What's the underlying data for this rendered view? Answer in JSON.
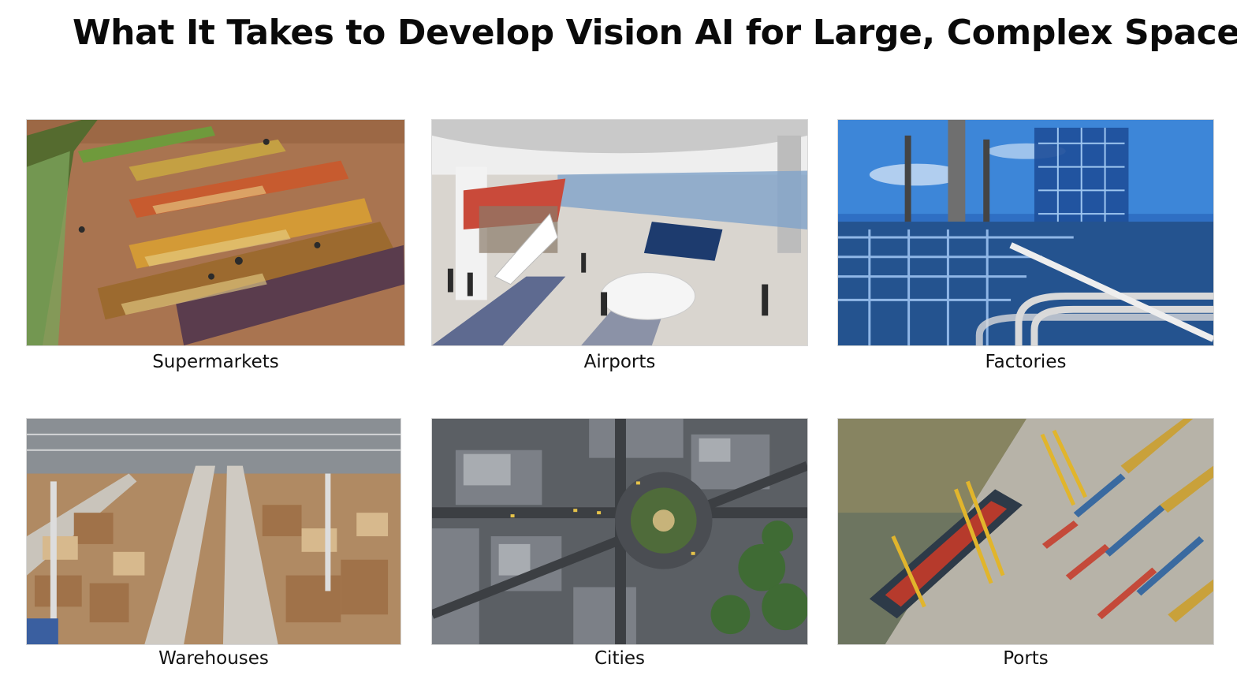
{
  "slide": {
    "title": "What It Takes to Develop Vision AI for Large, Complex Spaces?"
  },
  "tiles": [
    {
      "caption": "Supermarkets",
      "image": "supermarket-produce-aisles-photo"
    },
    {
      "caption": "Airports",
      "image": "airport-terminal-hall-photo"
    },
    {
      "caption": "Factories",
      "image": "industrial-refinery-pipes-photo"
    },
    {
      "caption": "Warehouses",
      "image": "warehouse-boxes-aisles-photo"
    },
    {
      "caption": "Cities",
      "image": "aerial-city-roundabout-photo"
    },
    {
      "caption": "Ports",
      "image": "aerial-container-port-ship-photo"
    }
  ]
}
